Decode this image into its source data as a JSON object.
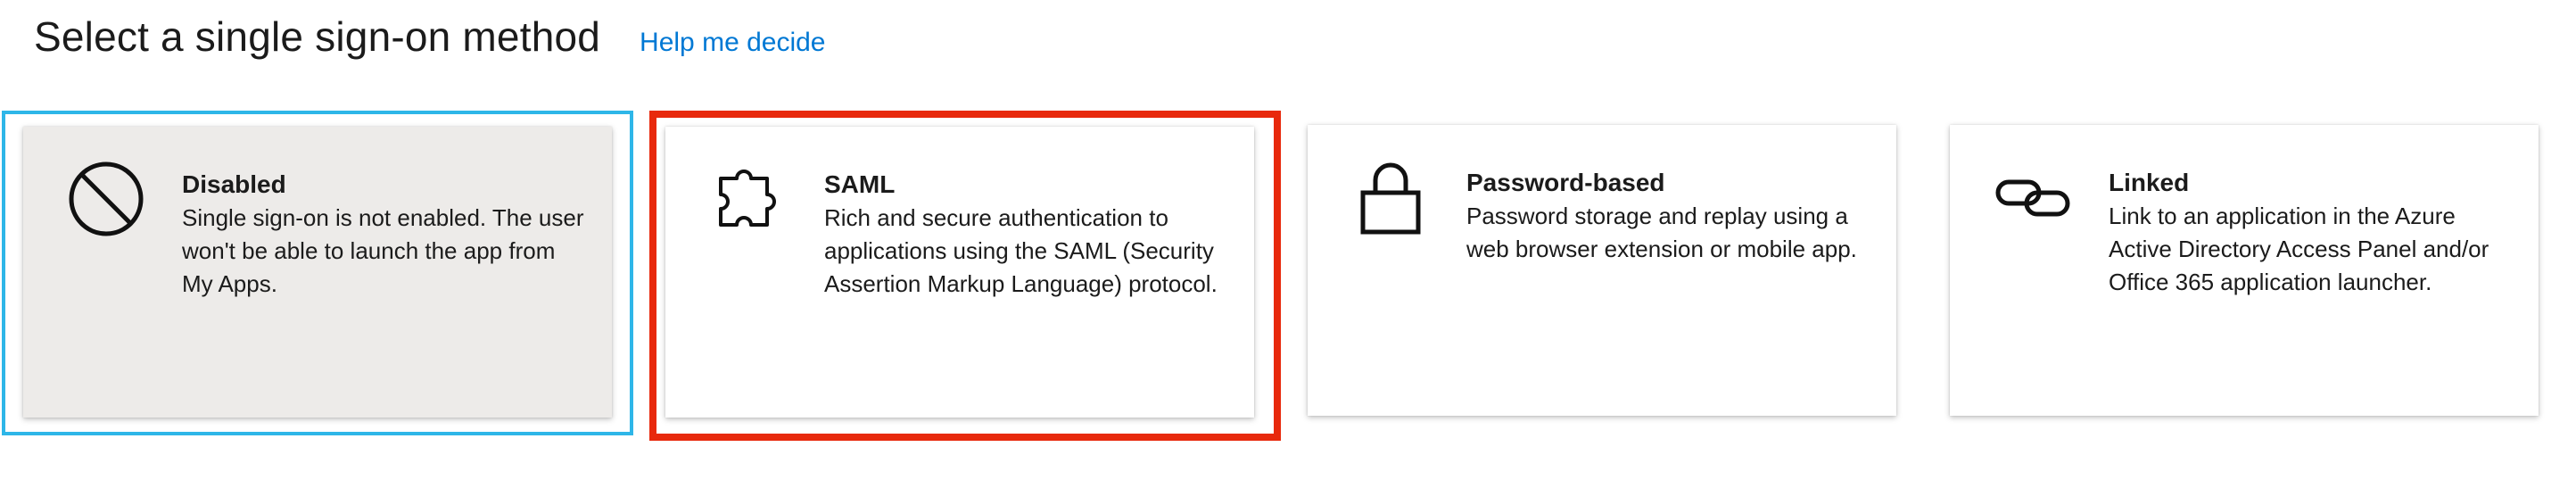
{
  "header": {
    "title": "Select a single sign-on method",
    "help_link": "Help me decide"
  },
  "methods": [
    {
      "title": "Disabled",
      "description": "Single sign-on is not enabled. The user won't be able to launch the app from My Apps.",
      "icon": "disabled-icon",
      "selected": true
    },
    {
      "title": "SAML",
      "description": "Rich and secure authentication to applications using the SAML (Security Assertion Markup Language) protocol.",
      "icon": "puzzle-icon",
      "selected": false
    },
    {
      "title": "Password-based",
      "description": "Password storage and replay using a web browser extension or mobile app.",
      "icon": "lock-icon",
      "selected": false
    },
    {
      "title": "Linked",
      "description": "Link to an application in the Azure Active Directory Access Panel and/or Office 365 application launcher.",
      "icon": "link-icon",
      "selected": false
    }
  ],
  "colors": {
    "link": "#0078d4",
    "selected_outline": "#2eb6e8",
    "highlight_outline": "#e8290c",
    "selected_tile_bg": "#edebe9"
  }
}
